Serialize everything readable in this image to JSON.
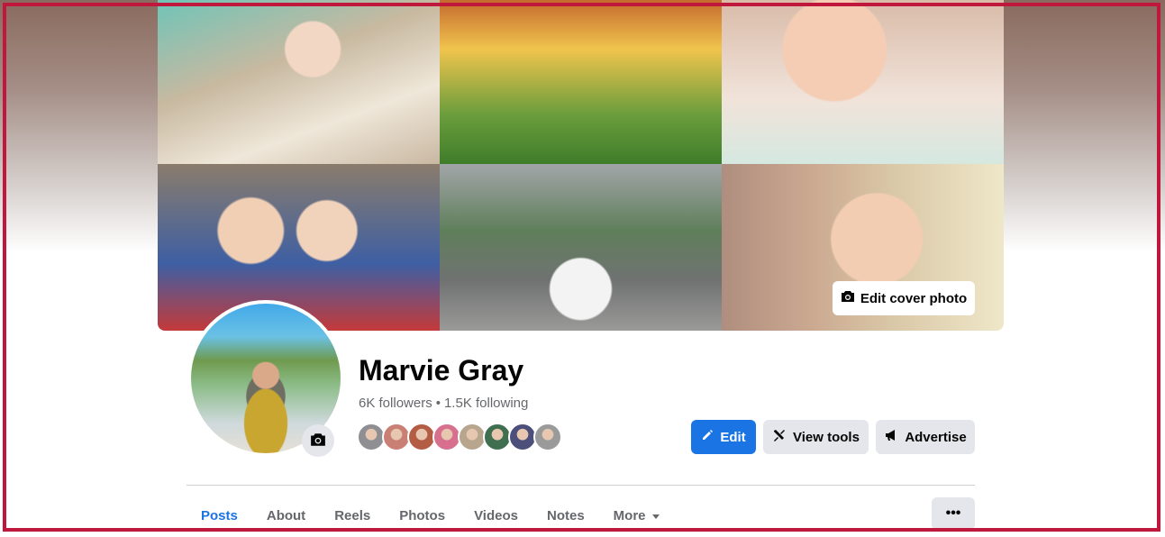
{
  "profile": {
    "name": "Marvie Gray",
    "followers": "6K followers",
    "separator": "•",
    "following": "1.5K following"
  },
  "cover": {
    "edit_label": "Edit cover photo",
    "icon": "camera-icon"
  },
  "avatar": {
    "camera_icon": "camera-icon"
  },
  "friends": {
    "colors": [
      "#8f8f93",
      "#c97f74",
      "#b35d45",
      "#d76f8e",
      "#b7a58e",
      "#3f6f4f",
      "#4b4f7a",
      "#9a9a9a"
    ]
  },
  "actions": {
    "edit_label": "Edit",
    "edit_icon": "pencil-icon",
    "view_tools_label": "View tools",
    "view_tools_icon": "tools-icon",
    "advertise_label": "Advertise",
    "advertise_icon": "megaphone-icon"
  },
  "tabs": [
    {
      "label": "Posts",
      "active": true
    },
    {
      "label": "About"
    },
    {
      "label": "Reels"
    },
    {
      "label": "Photos"
    },
    {
      "label": "Videos"
    },
    {
      "label": "Notes"
    },
    {
      "label": "More"
    }
  ],
  "more_menu_label": "•••",
  "colors": {
    "accent": "#1b74e4",
    "frame": "#c0183c",
    "secondary_button": "#e4e6eb"
  }
}
